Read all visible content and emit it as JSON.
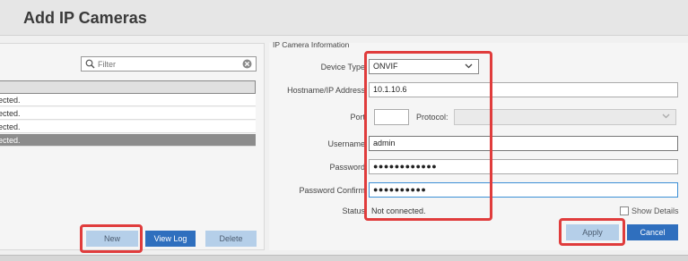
{
  "window": {
    "title": "Add IP Cameras"
  },
  "camera_list": {
    "filter_placeholder": "Filter",
    "rows": [
      {
        "status_text": "ected.",
        "selected": false
      },
      {
        "status_text": "ected.",
        "selected": false
      },
      {
        "status_text": "ected.",
        "selected": false
      },
      {
        "status_text": "ected.",
        "selected": true
      }
    ],
    "buttons": {
      "new": "New",
      "view_log": "View Log",
      "delete": "Delete"
    }
  },
  "camera_info": {
    "section_title": "IP Camera Information",
    "device_type": {
      "label": "Device Type",
      "value": "ONVIF"
    },
    "hostname": {
      "label": "Hostname/IP Address",
      "value": "10.1.10.6"
    },
    "port": {
      "label": "Port",
      "value": ""
    },
    "protocol": {
      "label": "Protocol:",
      "value": ""
    },
    "username": {
      "label": "Username",
      "value": "admin"
    },
    "password": {
      "label": "Password",
      "value": "●●●●●●●●●●●●"
    },
    "password_confirm": {
      "label": "Password Confirm",
      "value": "●●●●●●●●●●"
    },
    "status": {
      "label": "Status",
      "value": "Not connected."
    },
    "show_details_label": "Show Details",
    "buttons": {
      "apply": "Apply",
      "cancel": "Cancel"
    }
  },
  "colors": {
    "highlight": "#e03c3c",
    "primary_button": "#2f6fbe",
    "secondary_button": "#b5cfe9",
    "selected_row": "#8c8c8c"
  },
  "icons": [
    "search-icon",
    "clear-icon",
    "chevron-down-icon"
  ]
}
